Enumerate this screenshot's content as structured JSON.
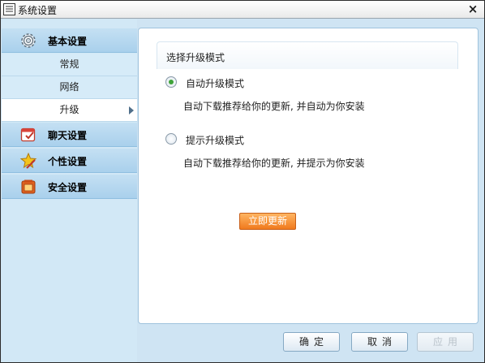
{
  "window": {
    "title": "系统设置",
    "close_label": "×"
  },
  "sidebar": {
    "basic": {
      "label": "基本设置",
      "icon": "gear-icon"
    },
    "basic_items": [
      "常规",
      "网络",
      "升级"
    ],
    "active_item": "升级",
    "chat": {
      "label": "聊天设置",
      "icon": "chat-calendar-icon"
    },
    "personal": {
      "label": "个性设置",
      "icon": "star-pencil-icon"
    },
    "security": {
      "label": "安全设置",
      "icon": "shield-safe-icon"
    }
  },
  "main": {
    "group_title": "选择升级模式",
    "options": [
      {
        "label": "自动升级模式",
        "description": "自动下载推荐给你的更新, 并自动为你安装",
        "checked": true
      },
      {
        "label": "提示升级模式",
        "description": "自动下载推荐给你的更新, 并提示为你安装",
        "checked": false
      }
    ],
    "update_now_label": "立即更新"
  },
  "footer": {
    "ok": "确定",
    "cancel": "取消",
    "apply": "应用"
  },
  "colors": {
    "accent_orange": "#f07a1e",
    "radio_green": "#3fa33a",
    "sidebar_bg": "#d2e8f6"
  }
}
